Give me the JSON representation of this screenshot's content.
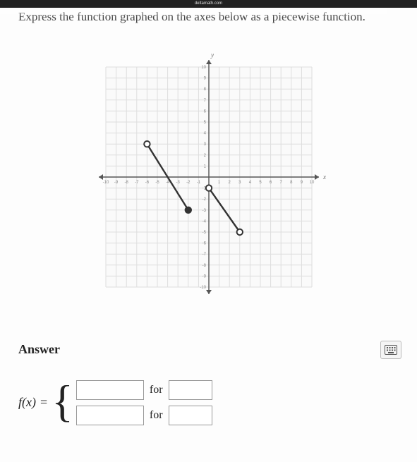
{
  "page": {
    "site_label": "deltamath.com",
    "question_text": "Express the function graphed on the axes below as a piecewise function.",
    "answer_heading": "Answer",
    "fx_label": "f(x)",
    "equals": "=",
    "for_label": "for",
    "keypad_icon_name": "keypad-icon"
  },
  "inputs": {
    "expr1": "",
    "cond1": "",
    "expr2": "",
    "cond2": ""
  },
  "chart_data": {
    "type": "line",
    "title": "",
    "xlabel": "x",
    "ylabel": "y",
    "xlim": [
      -10,
      10
    ],
    "ylim": [
      -10,
      10
    ],
    "x_ticks": [
      -10,
      -9,
      -8,
      -7,
      -6,
      -5,
      -4,
      -3,
      -2,
      -1,
      1,
      2,
      3,
      4,
      5,
      6,
      7,
      8,
      9,
      10
    ],
    "y_ticks": [
      -10,
      -9,
      -8,
      -7,
      -6,
      -5,
      -4,
      -3,
      -2,
      -1,
      1,
      2,
      3,
      4,
      5,
      6,
      7,
      8,
      9,
      10
    ],
    "series": [
      {
        "name": "segment1",
        "points": [
          {
            "x": -6,
            "y": 3,
            "endpoint": "open"
          },
          {
            "x": -2,
            "y": -3,
            "endpoint": "closed"
          }
        ]
      },
      {
        "name": "segment2",
        "points": [
          {
            "x": 0,
            "y": -1,
            "endpoint": "open"
          },
          {
            "x": 3,
            "y": -5,
            "endpoint": "open"
          }
        ]
      }
    ],
    "grid": true
  }
}
